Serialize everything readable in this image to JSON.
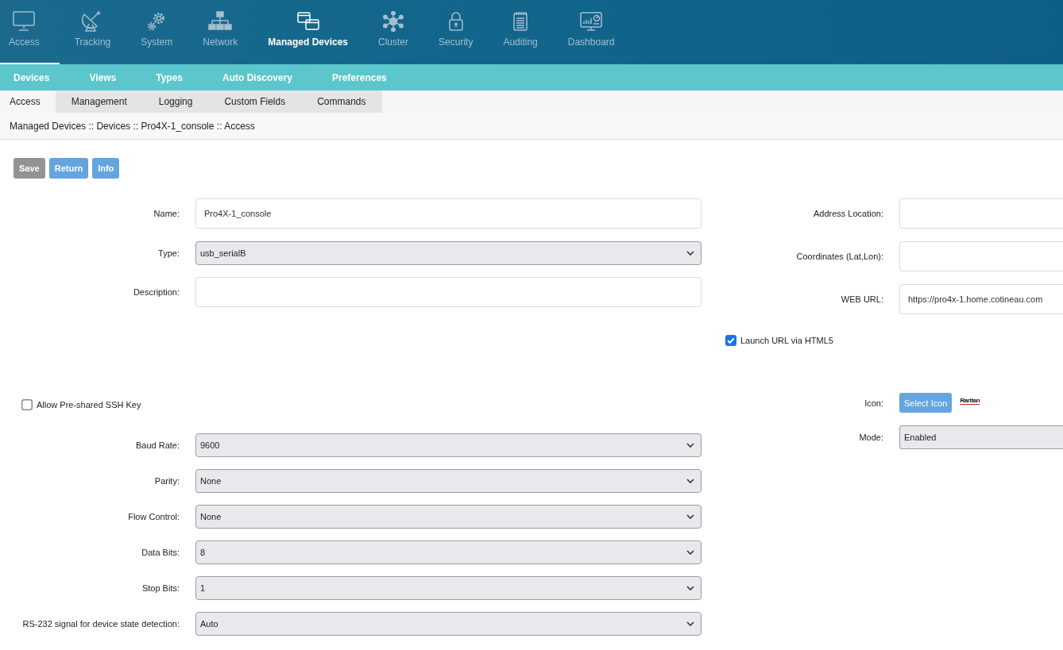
{
  "nav": [
    {
      "label": "Access",
      "selected": false,
      "highlighted": true
    },
    {
      "label": "Tracking",
      "selected": false,
      "highlighted": false
    },
    {
      "label": "System",
      "selected": false,
      "highlighted": false
    },
    {
      "label": "Network",
      "selected": false,
      "highlighted": false
    },
    {
      "label": "Managed Devices",
      "selected": true,
      "highlighted": false
    },
    {
      "label": "Cluster",
      "selected": false,
      "highlighted": false
    },
    {
      "label": "Security",
      "selected": false,
      "highlighted": false
    },
    {
      "label": "Auditing",
      "selected": false,
      "highlighted": false
    },
    {
      "label": "Dashboard",
      "selected": false,
      "highlighted": false
    }
  ],
  "subnav": [
    "Devices",
    "Views",
    "Types",
    "Auto Discovery",
    "Preferences"
  ],
  "tabs": [
    {
      "label": "Access",
      "selected": true
    },
    {
      "label": "Management",
      "selected": false
    },
    {
      "label": "Logging",
      "selected": false
    },
    {
      "label": "Custom Fields",
      "selected": false
    },
    {
      "label": "Commands",
      "selected": false
    }
  ],
  "breadcrumb": "Managed Devices :: Devices :: Pro4X-1_console :: Access",
  "buttons": [
    {
      "label": "Save",
      "disabled": true
    },
    {
      "label": "Return",
      "disabled": false
    },
    {
      "label": "Info",
      "disabled": false
    }
  ],
  "form": {
    "fields_left": [
      {
        "label": "Name:",
        "kind": "text",
        "value": "Pro4X-1_console"
      },
      {
        "label": "Type:",
        "kind": "select",
        "value": "usb_serialB"
      },
      {
        "label": "Description:",
        "kind": "text"
      }
    ],
    "fields_right": [
      {
        "label": "Address Location:",
        "kind": "text"
      },
      {
        "label": "Coordinates (Lat,Lon):",
        "kind": "text"
      },
      {
        "label": "WEB URL:",
        "kind": "text",
        "value": "https://pro4x-1.home.cotineau.com"
      }
    ],
    "launch_url": {
      "label": "Launch URL via HTML5",
      "checked": true
    },
    "ssh_key": {
      "label": "Allow Pre-shared SSH Key",
      "checked": false
    },
    "icon": {
      "label": "Icon:",
      "button": "Select Icon",
      "logo_text": "Raritan"
    },
    "mode": {
      "label": "Mode:",
      "kind": "select",
      "value": "Enabled"
    },
    "serial_settings": [
      {
        "label": "Baud Rate:",
        "kind": "select",
        "value": "9600"
      },
      {
        "label": "Parity:",
        "kind": "select",
        "value": "None"
      },
      {
        "label": "Flow Control:",
        "kind": "select",
        "value": "None"
      },
      {
        "label": "Data Bits:",
        "kind": "select",
        "value": "8"
      },
      {
        "label": "Stop Bits:",
        "kind": "select",
        "value": "1"
      },
      {
        "label": "RS-232 signal for device state detection:",
        "kind": "select",
        "value": "Auto"
      }
    ]
  }
}
